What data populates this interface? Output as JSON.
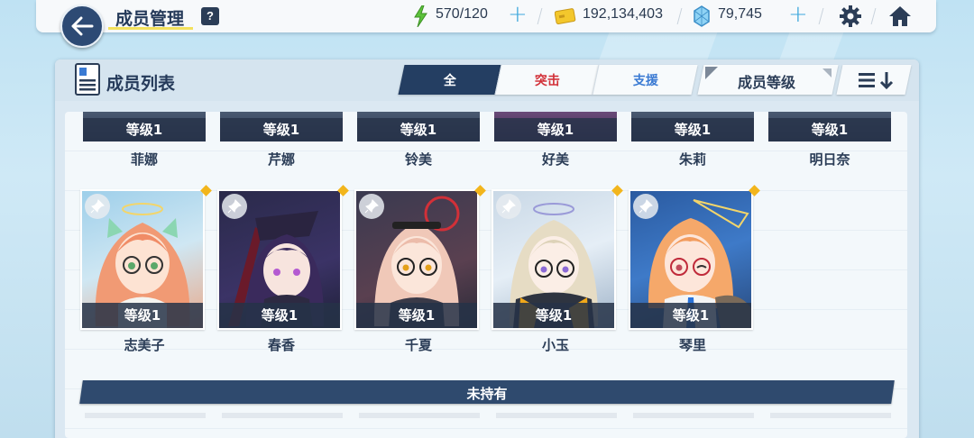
{
  "header": {
    "title": "成员管理",
    "help_label": "?",
    "stamina": "570/120",
    "credits": "192,134,403",
    "pyroxene": "79,745"
  },
  "panel": {
    "title": "成员列表",
    "filters": [
      "全",
      "突击",
      "支援"
    ],
    "sort_label": "成员等级"
  },
  "owned_top_row": [
    {
      "name": "菲娜",
      "level": "等级1"
    },
    {
      "name": "芹娜",
      "level": "等级1"
    },
    {
      "name": "铃美",
      "level": "等级1"
    },
    {
      "name": "好美",
      "level": "等级1"
    },
    {
      "name": "朱莉",
      "level": "等级1"
    },
    {
      "name": "明日奈",
      "level": "等级1"
    }
  ],
  "owned_row": [
    {
      "name": "志美子",
      "level": "等级1"
    },
    {
      "name": "春香",
      "level": "等级1"
    },
    {
      "name": "千夏",
      "level": "等级1"
    },
    {
      "name": "小玉",
      "level": "等级1"
    },
    {
      "name": "琴里",
      "level": "等级1"
    }
  ],
  "not_owned_label": "未持有",
  "colors": {
    "navy": "#243e62",
    "assault": "#d23038",
    "support": "#3a7ad3",
    "accent_plus": "#3ea8dc",
    "new_dot": "#f2b51c"
  }
}
